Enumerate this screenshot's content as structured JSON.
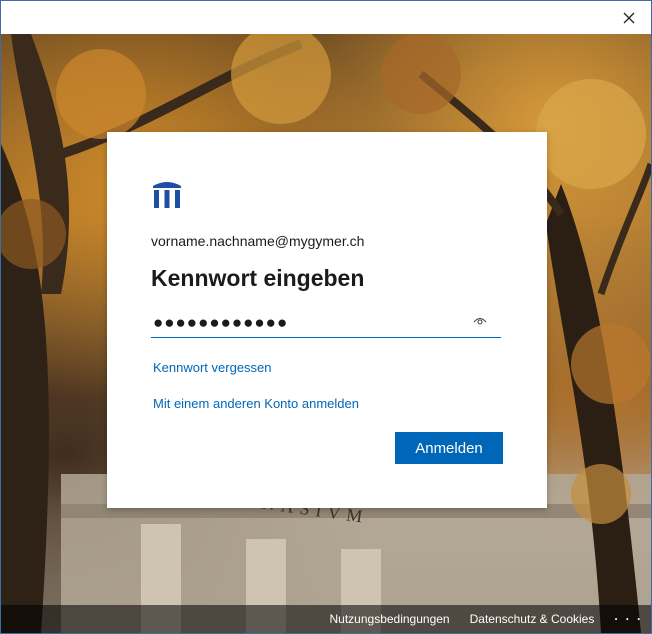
{
  "window": {
    "close_icon": "close-icon"
  },
  "card": {
    "logo_icon": "institution-pillars-icon",
    "logo_color": "#1f4ea3",
    "email": "vorname.nachname@mygymer.ch",
    "heading": "Kennwort eingeben",
    "password_value": "●●●●●●●●●●●●",
    "reveal_icon": "eye-icon",
    "forgot_link": "Kennwort vergessen",
    "other_account_link": "Mit einem anderen Konto anmelden",
    "signin_label": "Anmelden",
    "accent_color": "#0067b8"
  },
  "background": {
    "building_inscription": "GYMNASIVM"
  },
  "footer": {
    "terms": "Nutzungsbedingungen",
    "privacy": "Datenschutz & Cookies",
    "more": "· · ·"
  }
}
